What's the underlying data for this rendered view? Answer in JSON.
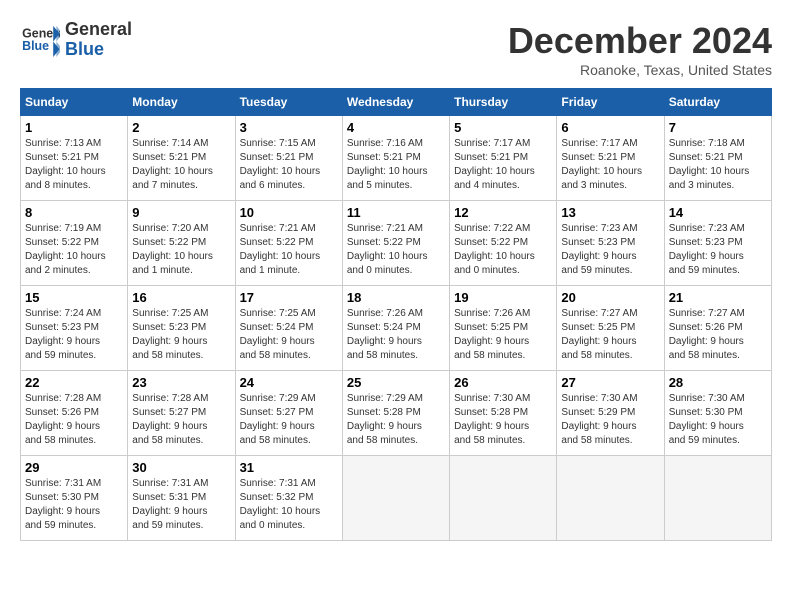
{
  "header": {
    "logo_line1": "General",
    "logo_line2": "Blue",
    "month": "December 2024",
    "location": "Roanoke, Texas, United States"
  },
  "days_of_week": [
    "Sunday",
    "Monday",
    "Tuesday",
    "Wednesday",
    "Thursday",
    "Friday",
    "Saturday"
  ],
  "weeks": [
    [
      {
        "day": "1",
        "info": "Sunrise: 7:13 AM\nSunset: 5:21 PM\nDaylight: 10 hours\nand 8 minutes."
      },
      {
        "day": "2",
        "info": "Sunrise: 7:14 AM\nSunset: 5:21 PM\nDaylight: 10 hours\nand 7 minutes."
      },
      {
        "day": "3",
        "info": "Sunrise: 7:15 AM\nSunset: 5:21 PM\nDaylight: 10 hours\nand 6 minutes."
      },
      {
        "day": "4",
        "info": "Sunrise: 7:16 AM\nSunset: 5:21 PM\nDaylight: 10 hours\nand 5 minutes."
      },
      {
        "day": "5",
        "info": "Sunrise: 7:17 AM\nSunset: 5:21 PM\nDaylight: 10 hours\nand 4 minutes."
      },
      {
        "day": "6",
        "info": "Sunrise: 7:17 AM\nSunset: 5:21 PM\nDaylight: 10 hours\nand 3 minutes."
      },
      {
        "day": "7",
        "info": "Sunrise: 7:18 AM\nSunset: 5:21 PM\nDaylight: 10 hours\nand 3 minutes."
      }
    ],
    [
      {
        "day": "8",
        "info": "Sunrise: 7:19 AM\nSunset: 5:22 PM\nDaylight: 10 hours\nand 2 minutes."
      },
      {
        "day": "9",
        "info": "Sunrise: 7:20 AM\nSunset: 5:22 PM\nDaylight: 10 hours\nand 1 minute."
      },
      {
        "day": "10",
        "info": "Sunrise: 7:21 AM\nSunset: 5:22 PM\nDaylight: 10 hours\nand 1 minute."
      },
      {
        "day": "11",
        "info": "Sunrise: 7:21 AM\nSunset: 5:22 PM\nDaylight: 10 hours\nand 0 minutes."
      },
      {
        "day": "12",
        "info": "Sunrise: 7:22 AM\nSunset: 5:22 PM\nDaylight: 10 hours\nand 0 minutes."
      },
      {
        "day": "13",
        "info": "Sunrise: 7:23 AM\nSunset: 5:23 PM\nDaylight: 9 hours\nand 59 minutes."
      },
      {
        "day": "14",
        "info": "Sunrise: 7:23 AM\nSunset: 5:23 PM\nDaylight: 9 hours\nand 59 minutes."
      }
    ],
    [
      {
        "day": "15",
        "info": "Sunrise: 7:24 AM\nSunset: 5:23 PM\nDaylight: 9 hours\nand 59 minutes."
      },
      {
        "day": "16",
        "info": "Sunrise: 7:25 AM\nSunset: 5:23 PM\nDaylight: 9 hours\nand 58 minutes."
      },
      {
        "day": "17",
        "info": "Sunrise: 7:25 AM\nSunset: 5:24 PM\nDaylight: 9 hours\nand 58 minutes."
      },
      {
        "day": "18",
        "info": "Sunrise: 7:26 AM\nSunset: 5:24 PM\nDaylight: 9 hours\nand 58 minutes."
      },
      {
        "day": "19",
        "info": "Sunrise: 7:26 AM\nSunset: 5:25 PM\nDaylight: 9 hours\nand 58 minutes."
      },
      {
        "day": "20",
        "info": "Sunrise: 7:27 AM\nSunset: 5:25 PM\nDaylight: 9 hours\nand 58 minutes."
      },
      {
        "day": "21",
        "info": "Sunrise: 7:27 AM\nSunset: 5:26 PM\nDaylight: 9 hours\nand 58 minutes."
      }
    ],
    [
      {
        "day": "22",
        "info": "Sunrise: 7:28 AM\nSunset: 5:26 PM\nDaylight: 9 hours\nand 58 minutes."
      },
      {
        "day": "23",
        "info": "Sunrise: 7:28 AM\nSunset: 5:27 PM\nDaylight: 9 hours\nand 58 minutes."
      },
      {
        "day": "24",
        "info": "Sunrise: 7:29 AM\nSunset: 5:27 PM\nDaylight: 9 hours\nand 58 minutes."
      },
      {
        "day": "25",
        "info": "Sunrise: 7:29 AM\nSunset: 5:28 PM\nDaylight: 9 hours\nand 58 minutes."
      },
      {
        "day": "26",
        "info": "Sunrise: 7:30 AM\nSunset: 5:28 PM\nDaylight: 9 hours\nand 58 minutes."
      },
      {
        "day": "27",
        "info": "Sunrise: 7:30 AM\nSunset: 5:29 PM\nDaylight: 9 hours\nand 58 minutes."
      },
      {
        "day": "28",
        "info": "Sunrise: 7:30 AM\nSunset: 5:30 PM\nDaylight: 9 hours\nand 59 minutes."
      }
    ],
    [
      {
        "day": "29",
        "info": "Sunrise: 7:31 AM\nSunset: 5:30 PM\nDaylight: 9 hours\nand 59 minutes."
      },
      {
        "day": "30",
        "info": "Sunrise: 7:31 AM\nSunset: 5:31 PM\nDaylight: 9 hours\nand 59 minutes."
      },
      {
        "day": "31",
        "info": "Sunrise: 7:31 AM\nSunset: 5:32 PM\nDaylight: 10 hours\nand 0 minutes."
      },
      null,
      null,
      null,
      null
    ]
  ]
}
